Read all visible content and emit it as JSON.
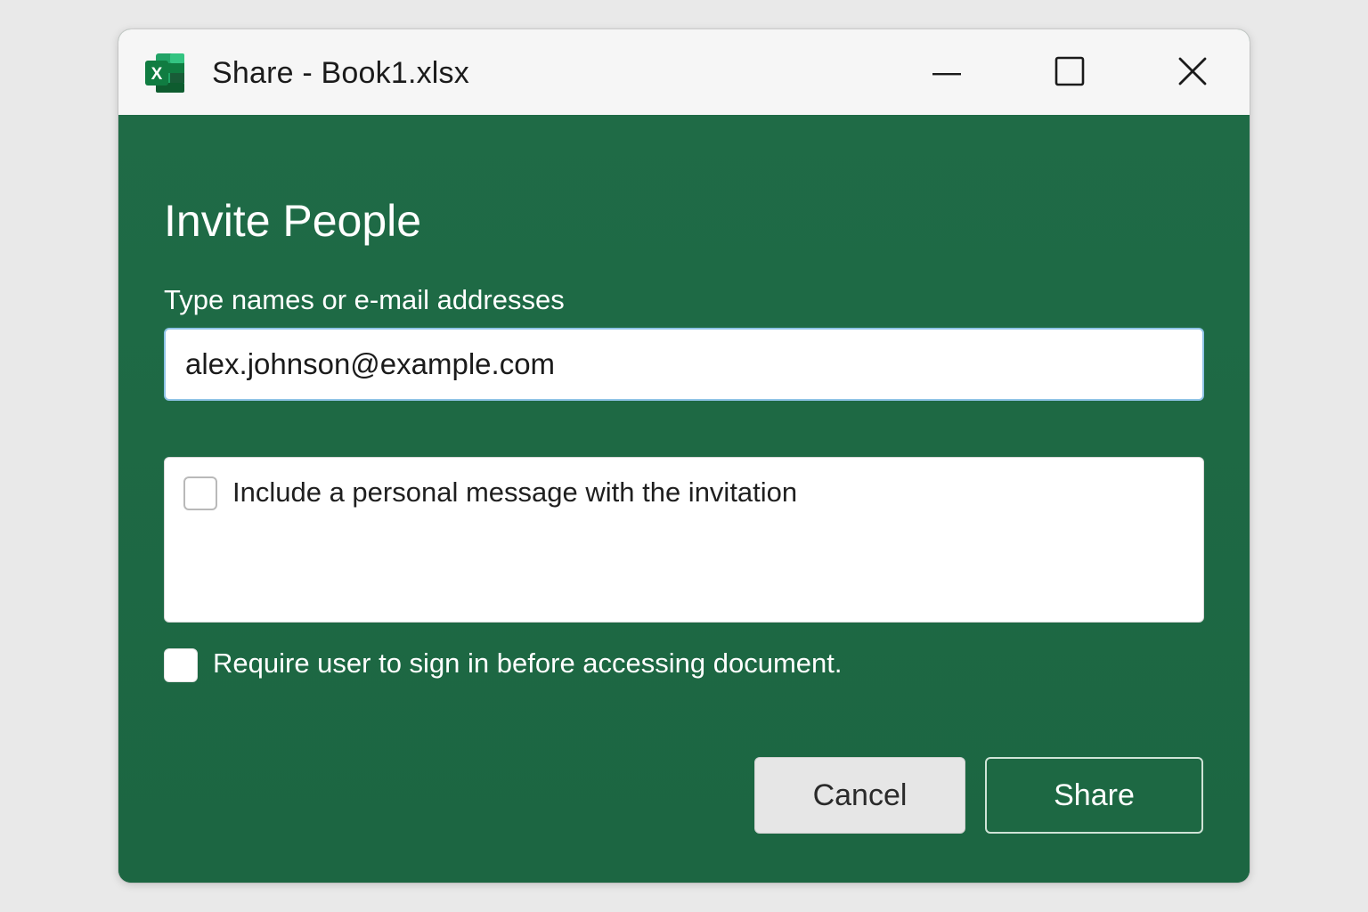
{
  "window": {
    "title": "Share - Book1.xlsx",
    "app_icon": "excel-icon",
    "controls": {
      "minimize_icon": "minimize-icon",
      "maximize_icon": "maximize-icon",
      "close_icon": "close-icon"
    }
  },
  "dialog": {
    "heading": "Invite People",
    "recipients_label": "Type names or e-mail addresses",
    "recipients_value": "alex.johnson@example.com",
    "personal_message_label": "Include a personal message with the invitation",
    "personal_message_checked": false,
    "require_signin_label": "Require user to sign in before accessing document.",
    "require_signin_checked": false,
    "cancel_label": "Cancel",
    "share_label": "Share"
  },
  "colors": {
    "accent_green": "#1e6a45",
    "titlebar": "#f6f6f6",
    "input_focus_border": "#8fc3e6"
  }
}
